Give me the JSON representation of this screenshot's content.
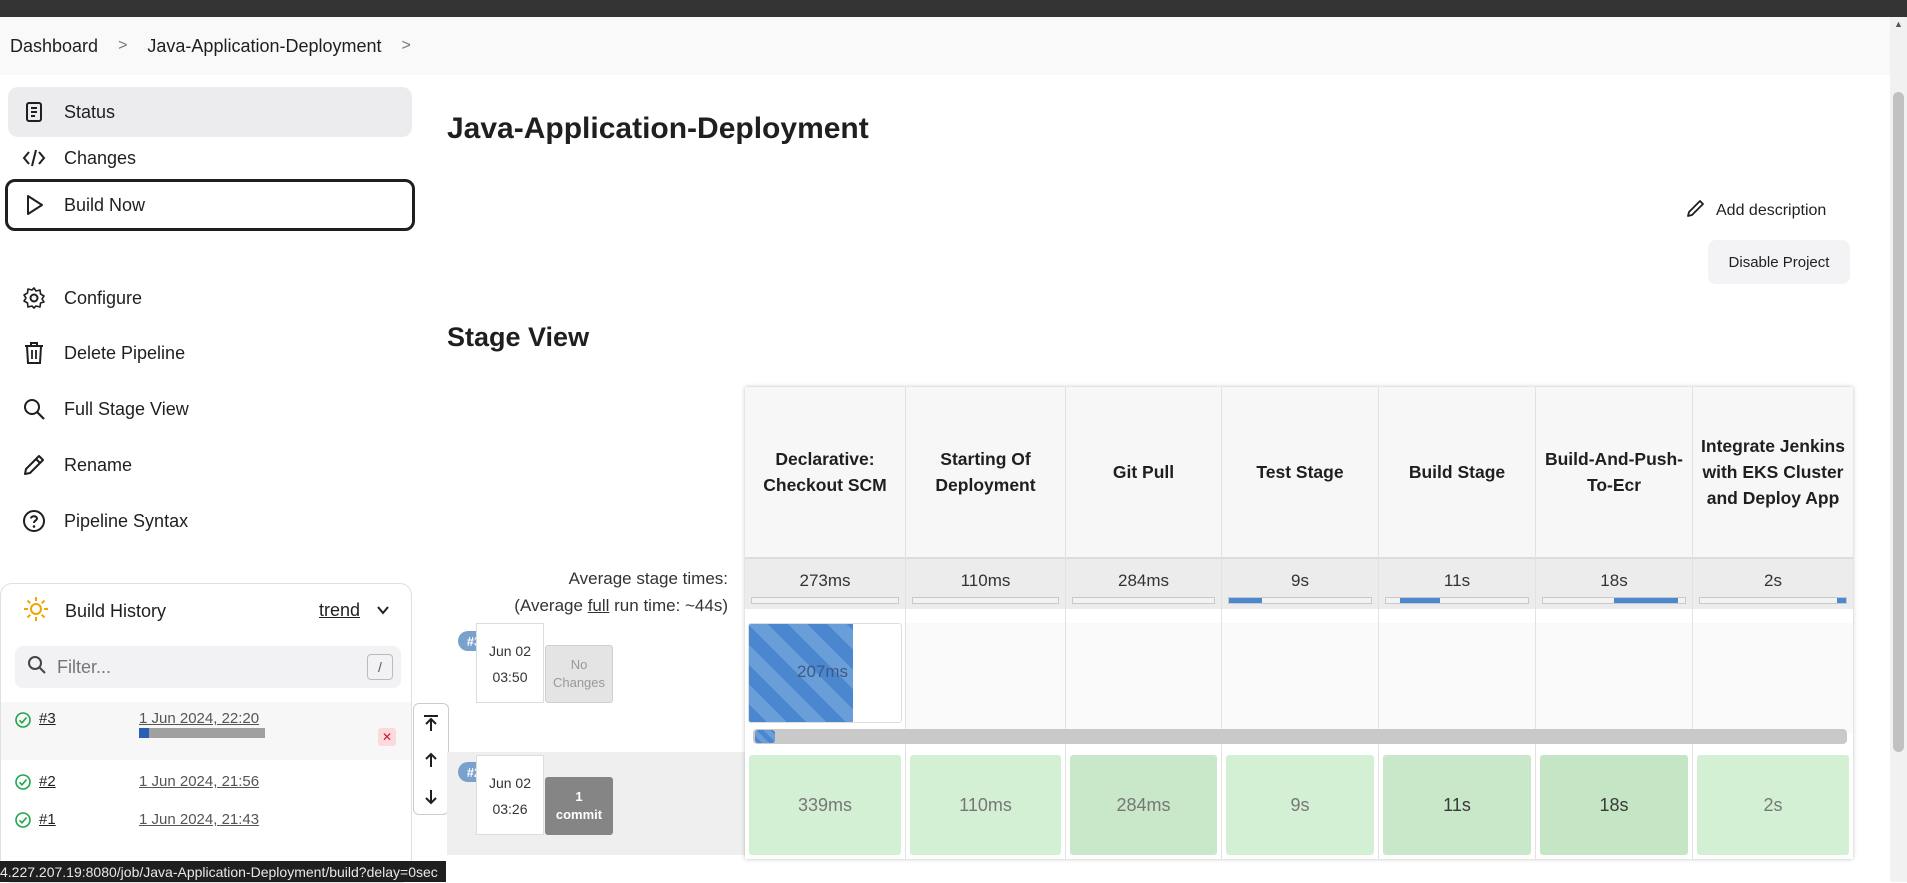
{
  "breadcrumbs": [
    "Dashboard",
    "Java-Application-Deployment"
  ],
  "sidebar": {
    "tasks": [
      {
        "label": "Status",
        "icon": "document-icon"
      },
      {
        "label": "Changes",
        "icon": "code-icon"
      },
      {
        "label": "Build Now",
        "icon": "play-icon"
      },
      {
        "label": "Configure",
        "icon": "gear-icon"
      },
      {
        "label": "Delete Pipeline",
        "icon": "trash-icon"
      },
      {
        "label": "Full Stage View",
        "icon": "search-icon"
      },
      {
        "label": "Rename",
        "icon": "pencil-icon"
      },
      {
        "label": "Pipeline Syntax",
        "icon": "help-icon"
      }
    ]
  },
  "history": {
    "title": "Build History",
    "trend": "trend",
    "filter_placeholder": "Filter...",
    "filter_shortcut": "/",
    "builds": [
      {
        "num": "#3",
        "date": "1 Jun 2024, 22:20",
        "progress": 0.08
      },
      {
        "num": "#2",
        "date": "1 Jun 2024, 21:56"
      },
      {
        "num": "#1",
        "date": "1 Jun 2024, 21:43"
      }
    ]
  },
  "page": {
    "title": "Java-Application-Deployment",
    "add_description": "Add description",
    "disable_project": "Disable Project",
    "stage_view_title": "Stage View",
    "avg_stage_times": "Average stage times:",
    "avg_full_prefix": "(Average ",
    "avg_full_link": "full",
    "avg_full_suffix": " run time: ~44s)"
  },
  "stages": [
    {
      "name": "Declarative: Checkout SCM",
      "avg": "273ms",
      "bar": [
        0,
        0
      ]
    },
    {
      "name": "Starting Of Deployment",
      "avg": "110ms",
      "bar": [
        0,
        0
      ]
    },
    {
      "name": "Git Pull",
      "avg": "284ms",
      "bar": [
        0,
        0
      ]
    },
    {
      "name": "Test Stage",
      "avg": "9s",
      "bar": [
        0,
        0.23
      ]
    },
    {
      "name": "Build Stage",
      "avg": "11s",
      "bar": [
        0.1,
        0.38
      ]
    },
    {
      "name": "Build-And-Push-To-Ecr",
      "avg": "18s",
      "bar": [
        0.5,
        0.95
      ]
    },
    {
      "name": "Integrate Jenkins with EKS Cluster and Deploy App",
      "avg": "2s",
      "bar": [
        0.94,
        1
      ]
    }
  ],
  "runs": [
    {
      "badge": "#3",
      "date": "Jun 02",
      "time": "03:50",
      "changes": "No Changes",
      "first_stage": "207ms"
    },
    {
      "badge": "#2",
      "date": "Jun 02",
      "time": "03:26",
      "changes_count": "1",
      "changes_label": "commit",
      "times": [
        "339ms",
        "110ms",
        "284ms",
        "9s",
        "11s",
        "18s",
        "2s"
      ]
    }
  ],
  "status_url": "4.227.207.19:8080/job/Java-Application-Deployment/build?delay=0sec",
  "colors": {
    "stage_success": "#d4f0d4",
    "progress_blue": "#4a88d1",
    "cancel_red": "#d11a2a"
  }
}
